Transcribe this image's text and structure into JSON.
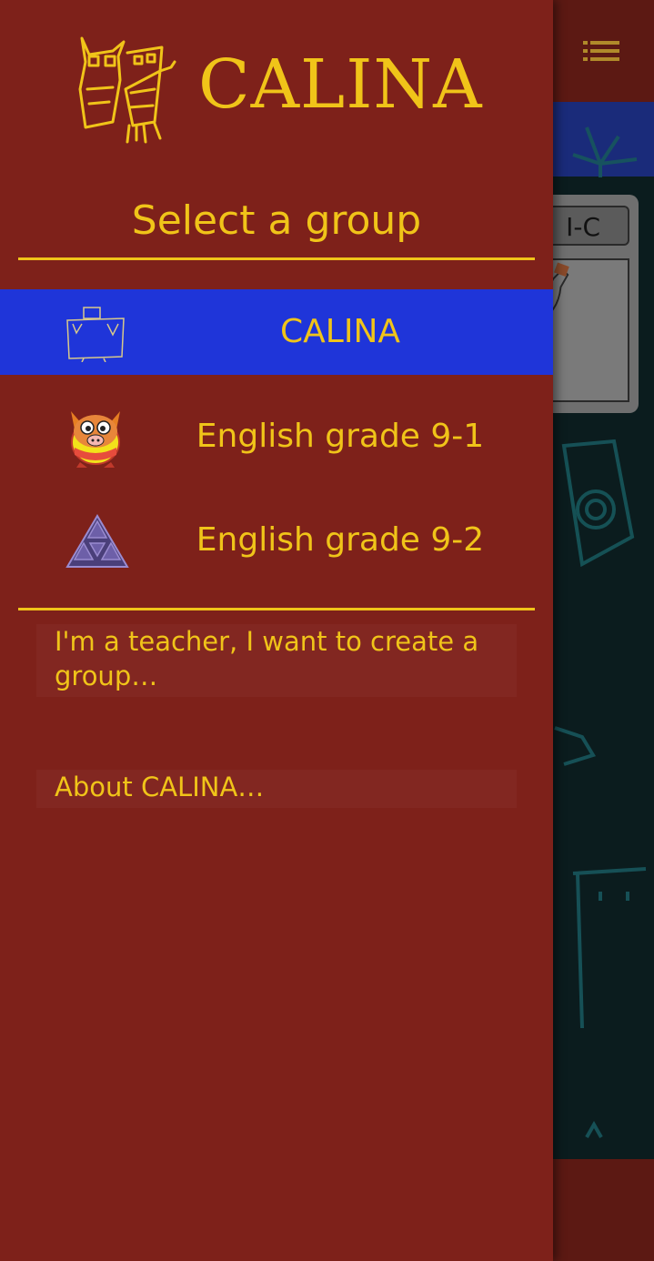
{
  "background": {
    "card_badge": "I-C"
  },
  "drawer": {
    "logo_text": "CALINA",
    "title": "Select a group",
    "groups": [
      {
        "label": "CALINA",
        "icon": "calina-figure-icon",
        "selected": true
      },
      {
        "label": "English grade 9-1",
        "icon": "boar-mascot-icon",
        "selected": false
      },
      {
        "label": "English grade 9-2",
        "icon": "triangle-icon",
        "selected": false
      }
    ],
    "actions": {
      "teacher": "I'm a teacher, I want to create a group…",
      "about": "About CALINA…"
    }
  },
  "colors": {
    "drawer_bg": "#7e211a",
    "accent_yellow": "#f0c419",
    "selected_bg": "#1f35d9",
    "appbar_bg": "#5c1913"
  }
}
